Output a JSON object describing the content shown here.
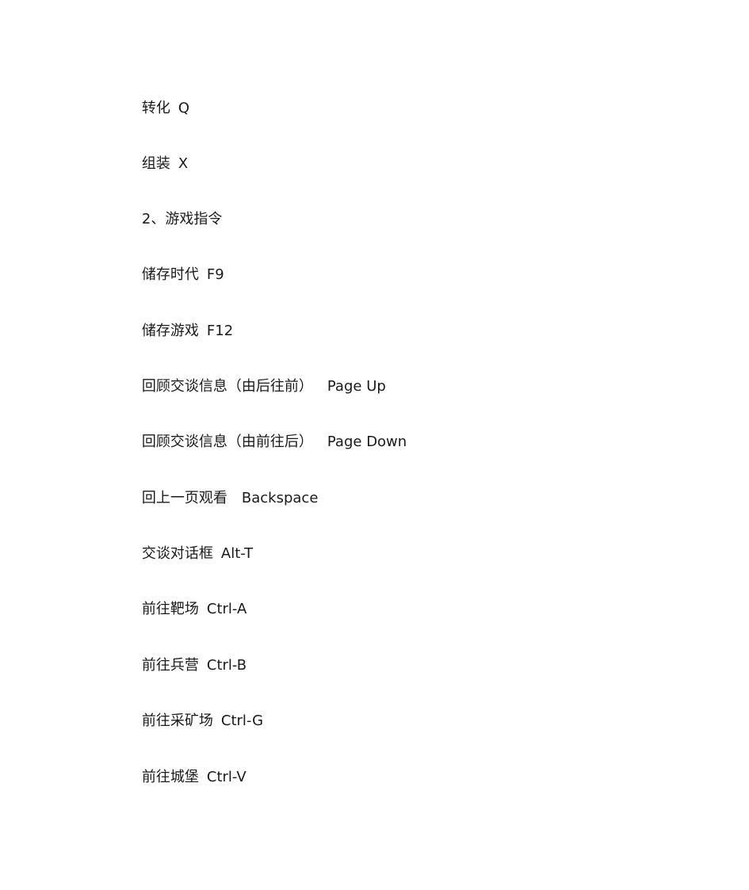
{
  "document": {
    "lines": [
      {
        "label": "转化",
        "key": "Q"
      },
      {
        "label": "组装",
        "key": "X"
      },
      {
        "heading": "2、游戏指令"
      },
      {
        "label": "储存时代",
        "key": "F9"
      },
      {
        "label": "储存游戏",
        "key": "F12"
      },
      {
        "label": "回顾交谈信息（由后往前）",
        "key": "Page Up"
      },
      {
        "label": "回顾交谈信息（由前往后）",
        "key": "Page Down"
      },
      {
        "label": "回上一页观看",
        "key": "Backspace"
      },
      {
        "label": "交谈对话框",
        "key": "Alt-T"
      },
      {
        "label": "前往靶场",
        "key": "Ctrl-A"
      },
      {
        "label": "前往兵营",
        "key": "Ctrl-B"
      },
      {
        "label": "前往采矿场",
        "key": "Ctrl-G"
      },
      {
        "label": "前往城堡",
        "key": "Ctrl-V"
      }
    ]
  }
}
